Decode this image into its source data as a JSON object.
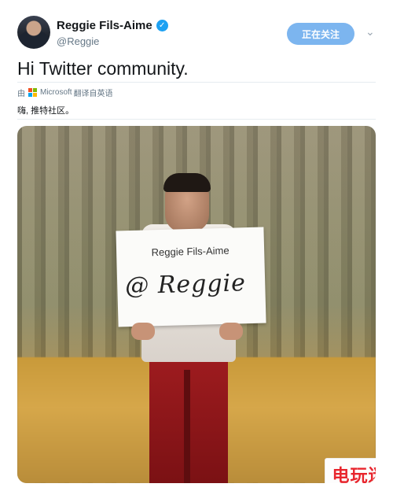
{
  "account": {
    "name": "Reggie Fils-Aime",
    "handle": "@Reggie",
    "verified_badge": "✓"
  },
  "actions": {
    "follow_label": "正在关注",
    "more_icon": "chevron-down-icon"
  },
  "tweet": {
    "text": "Hi Twitter community.",
    "translation_prefix": "由",
    "translation_brand": "Microsoft",
    "translation_suffix": "翻译自英语",
    "translated_text": "嗨, 推特社区。"
  },
  "media": {
    "sign_title": "Reggie Fils-Aime",
    "sign_handwriting": "@ Reggie",
    "watermark": "电玩迷"
  }
}
